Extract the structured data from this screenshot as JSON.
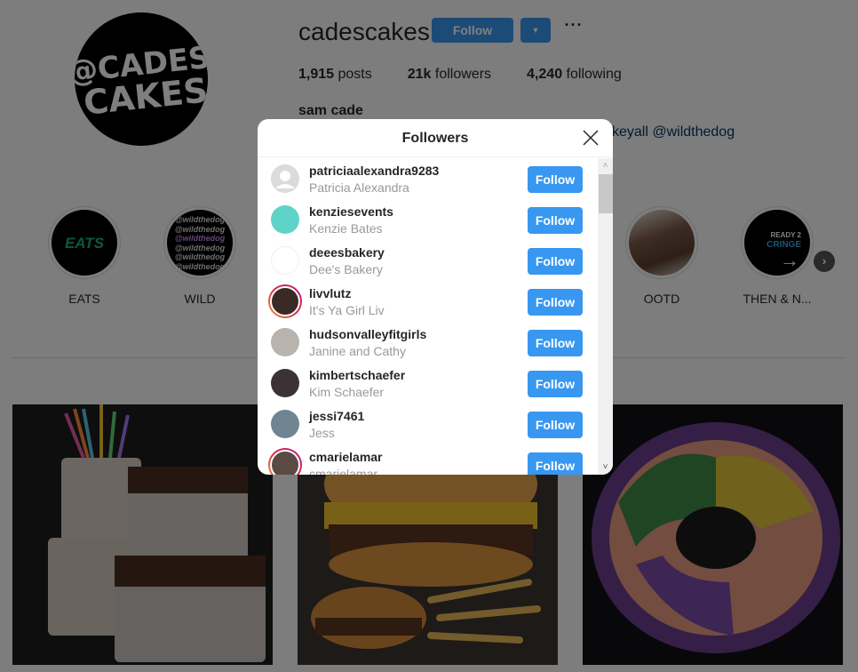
{
  "profile": {
    "username": "cadescakes",
    "follow_label": "Follow",
    "dropdown_icon": "caret-down-icon",
    "more_icon": "ellipsis-icon",
    "more_glyph": "···",
    "stats": {
      "posts_count": "1,915",
      "posts_label": "posts",
      "followers_count": "21k",
      "followers_label": "followers",
      "following_count": "4,240",
      "following_label": "following"
    },
    "full_name": "sam cade",
    "bio_visible_fragment": "keyall @wildthedog",
    "avatar_text": [
      "@CADES",
      "CAKES"
    ]
  },
  "highlights": [
    {
      "label": "EATS"
    },
    {
      "label": "WILD"
    },
    {
      "label": "OOTD"
    },
    {
      "label": "THEN & N..."
    }
  ],
  "highlights_next_glyph": "›",
  "posts": [
    {
      "alt": "chocolate drip and sprinkle cakes"
    },
    {
      "alt": "cheeseburger cake with fries"
    },
    {
      "alt": "king cake"
    }
  ],
  "modal": {
    "title": "Followers",
    "close_icon": "close-icon",
    "follow_label": "Follow",
    "followers": [
      {
        "username": "patriciaalexandra9283",
        "full_name": "Patricia Alexandra",
        "story": false,
        "avatar_color": "#dbdbdb"
      },
      {
        "username": "kenziesevents",
        "full_name": "Kenzie Bates",
        "story": false,
        "avatar_color": "#5fd3c8"
      },
      {
        "username": "deeesbakery",
        "full_name": "Dee's Bakery",
        "story": false,
        "avatar_color": "#ffffff"
      },
      {
        "username": "livvlutz",
        "full_name": "It's Ya Girl Liv",
        "story": true,
        "avatar_color": "#3a2a26"
      },
      {
        "username": "hudsonvalleyfitgirls",
        "full_name": "Janine and Cathy",
        "story": false,
        "avatar_color": "#b9b3ad"
      },
      {
        "username": "kimbertschaefer",
        "full_name": "Kim Schaefer",
        "story": false,
        "avatar_color": "#3b3238"
      },
      {
        "username": "jessi7461",
        "full_name": "Jess",
        "story": false,
        "avatar_color": "#6f8592"
      },
      {
        "username": "cmarielamar",
        "full_name": "cmarielamar",
        "story": true,
        "avatar_color": "#5a4a44"
      }
    ]
  },
  "scrollbar": {
    "up_glyph": "˄",
    "down_glyph": "˅"
  },
  "colors": {
    "accent": "#3897f0",
    "overlay": "rgba(0,0,0,0.5)"
  }
}
